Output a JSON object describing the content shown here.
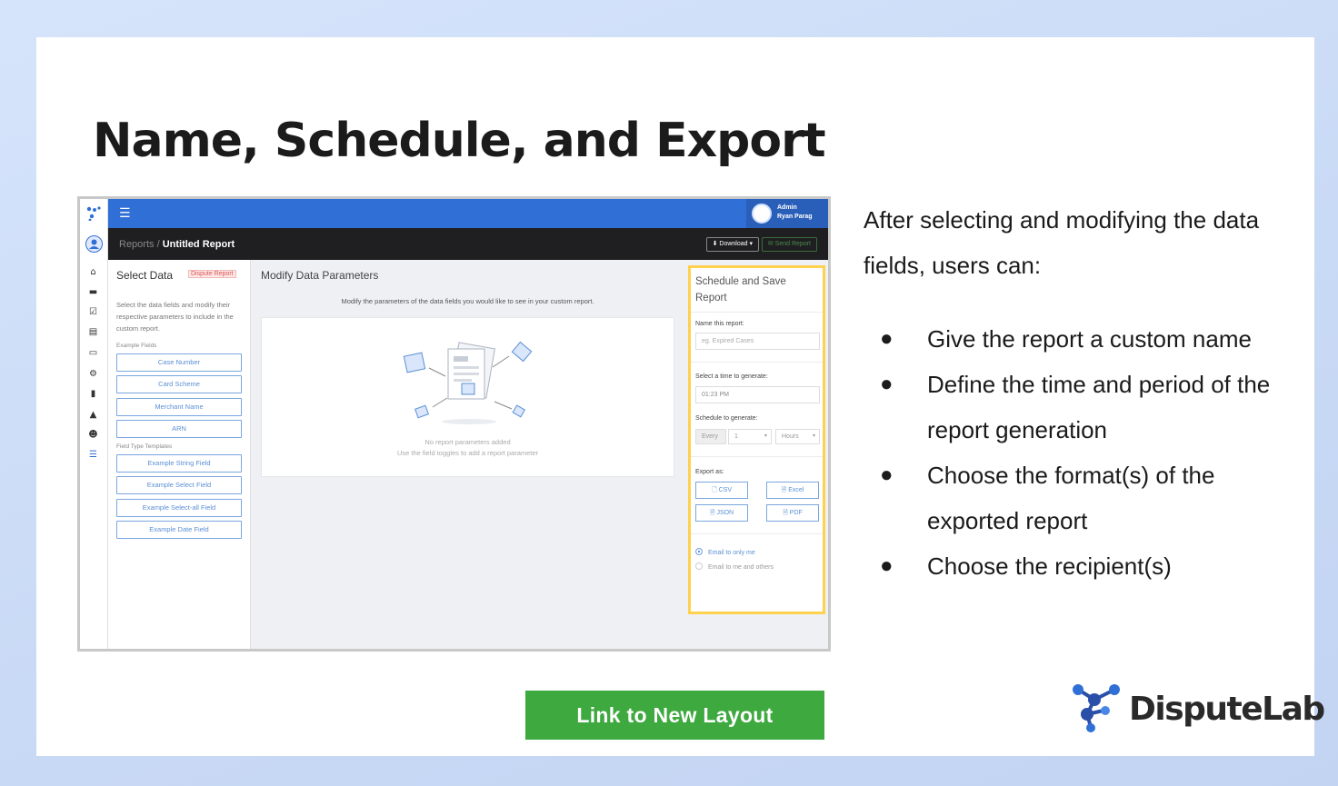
{
  "slide": {
    "title": "Name, Schedule, and Export",
    "intro": "After selecting and modifying the data fields, users can:",
    "bullets": [
      "Give the report a custom name",
      "Define the time and period of the report generation",
      "Choose the format(s) of the exported report",
      "Choose the recipient(s)"
    ],
    "bullet_char": "●",
    "link_button": "Link to New Layout",
    "logo_text": "DisputeLab"
  },
  "app": {
    "user": {
      "role": "Admin",
      "name": "Ryan Parag"
    },
    "breadcrumb": {
      "root": "Reports",
      "sep": " / ",
      "current": "Untitled Report"
    },
    "download_label": "⬇ Download ▾",
    "send_label": "✉ Send Report",
    "left": {
      "title": "Select Data",
      "tag": "Dispute Report",
      "desc": "Select the data fields and modify their respective parameters to include in the custom report.",
      "example_fields_label": "Example Fields",
      "example_fields": [
        "Case Number",
        "Card Scheme",
        "Merchant Name",
        "ARN"
      ],
      "templates_label": "Field Type Templates",
      "templates": [
        "Example String Field",
        "Example Select Field",
        "Example Select-all Field",
        "Example Date Field"
      ]
    },
    "middle": {
      "title": "Modify Data Parameters",
      "desc": "Modify the parameters of the data fields you would like to see in your custom report.",
      "empty_title": "No report parameters added",
      "empty_hint": "Use the field toggles to add a report parameter"
    },
    "right": {
      "title": "Schedule and Save Report",
      "name_label": "Name this report:",
      "name_placeholder": "eg. Expired Cases",
      "time_label": "Select a time to generate:",
      "time_value": "01:23 PM",
      "schedule_label": "Schedule to generate:",
      "schedule_every": "Every",
      "schedule_num": "1",
      "schedule_unit": "Hours",
      "export_label": "Export as:",
      "exports": [
        "🗋 CSV",
        "🗎 Excel",
        "🗎 JSON",
        "🗎 PDF"
      ],
      "email_options": [
        "Email to only me",
        "Email to me and others"
      ]
    }
  },
  "colors": {
    "accent": "#2f6fd6",
    "dark_bar": "#1f1f22",
    "highlight": "#ffd24d",
    "button_green": "#3da93f"
  }
}
